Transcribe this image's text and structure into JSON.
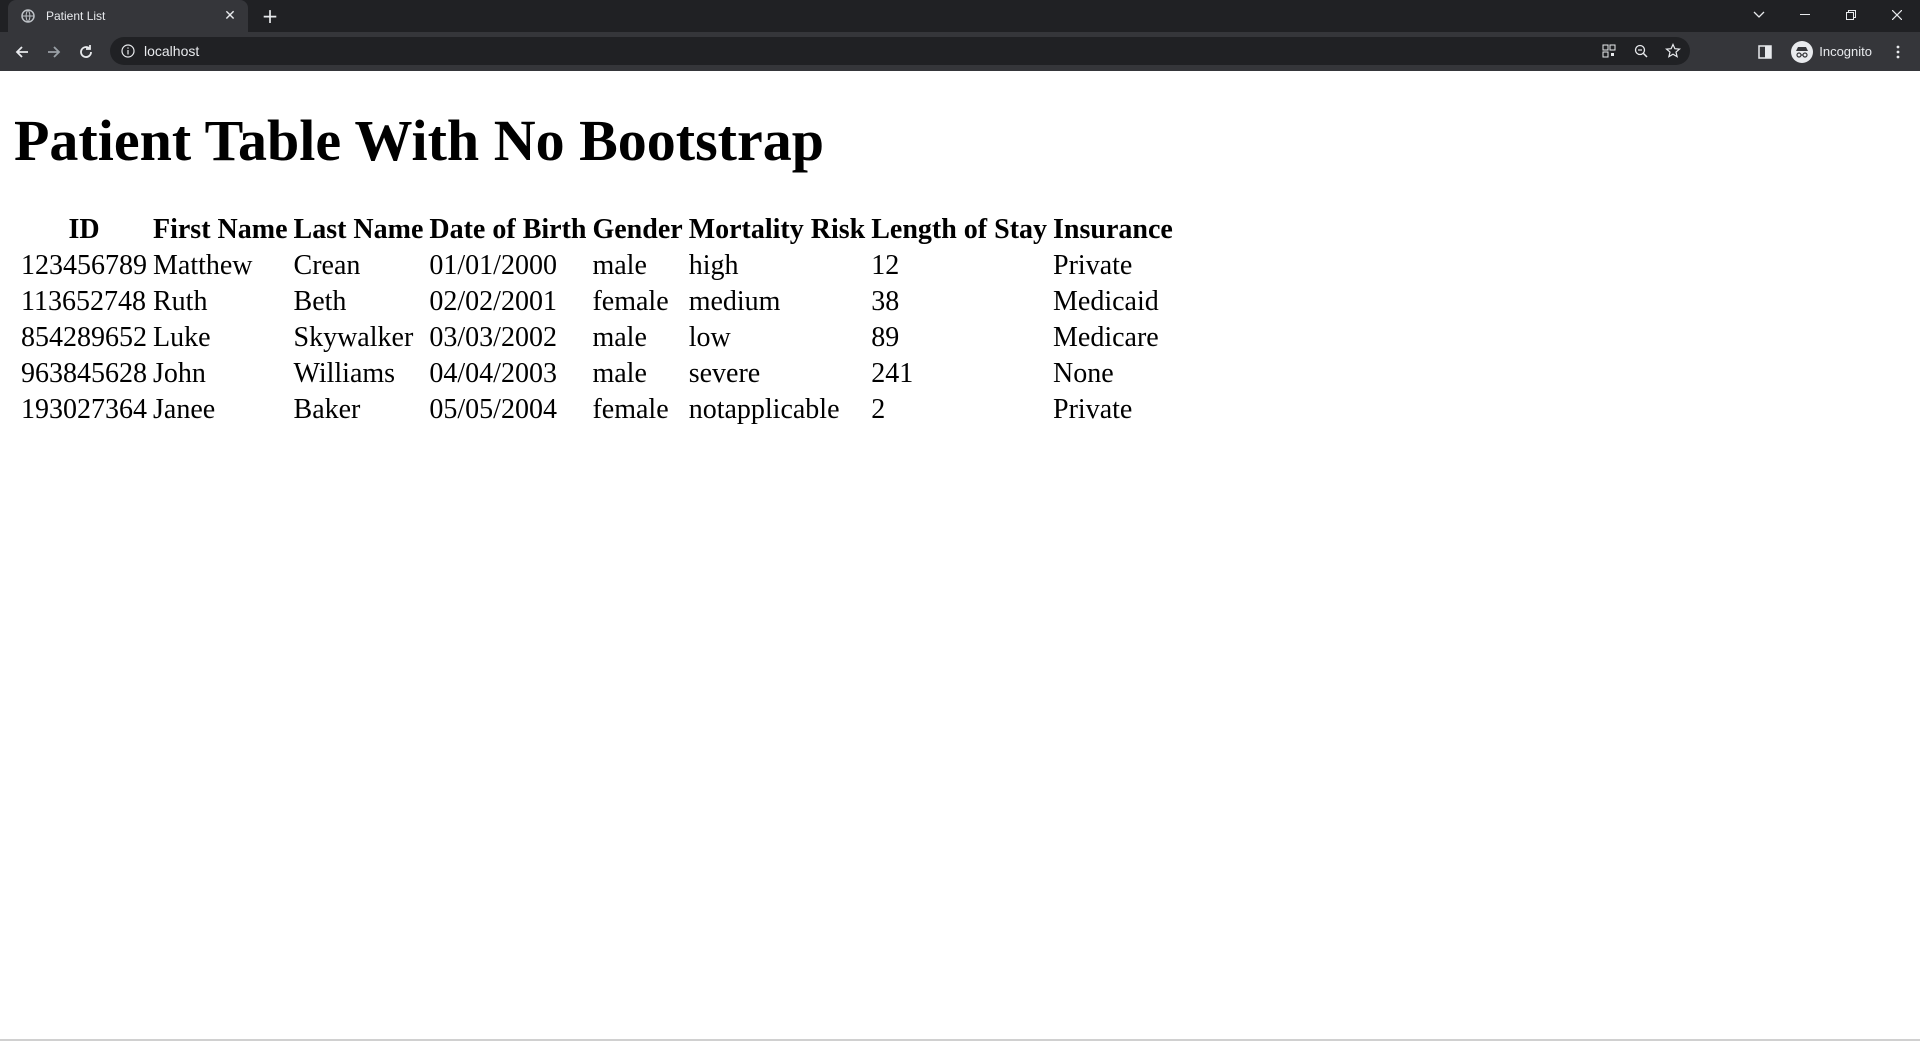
{
  "browser": {
    "tab_title": "Patient List",
    "url": "localhost",
    "profile_label": "Incognito"
  },
  "page": {
    "heading": "Patient Table With No Bootstrap",
    "table": {
      "headers": [
        "ID",
        "First Name",
        "Last Name",
        "Date of Birth",
        "Gender",
        "Mortality Risk",
        "Length of Stay",
        "Insurance"
      ],
      "rows": [
        [
          "123456789",
          "Matthew",
          "Crean",
          "01/01/2000",
          "male",
          "high",
          "12",
          "Private"
        ],
        [
          "113652748",
          "Ruth",
          "Beth",
          "02/02/2001",
          "female",
          "medium",
          "38",
          "Medicaid"
        ],
        [
          "854289652",
          "Luke",
          "Skywalker",
          "03/03/2002",
          "male",
          "low",
          "89",
          "Medicare"
        ],
        [
          "963845628",
          "John",
          "Williams",
          "04/04/2003",
          "male",
          "severe",
          "241",
          "None"
        ],
        [
          "193027364",
          "Janee",
          "Baker",
          "05/05/2004",
          "female",
          "notapplicable",
          "2",
          "Private"
        ]
      ]
    }
  },
  "icons": {
    "favicon": "globe-icon",
    "close": "close-icon",
    "new_tab": "plus-icon",
    "back": "back-arrow-icon",
    "forward": "forward-arrow-icon",
    "reload": "reload-icon",
    "info": "info-icon",
    "qr": "qr-code-icon",
    "zoom": "zoom-icon",
    "bookmark": "star-icon",
    "side_panel": "side-panel-icon",
    "incognito": "incognito-icon",
    "menu": "kebab-menu-icon"
  }
}
